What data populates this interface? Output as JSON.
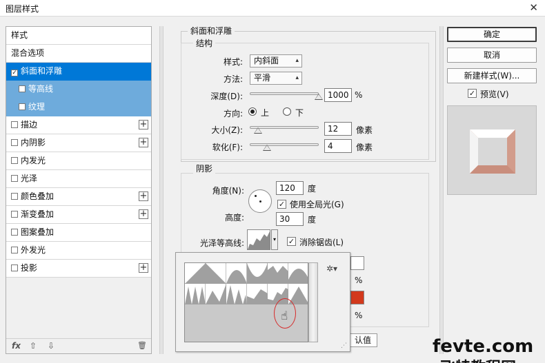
{
  "window": {
    "title": "图层样式",
    "close_glyph": "✕"
  },
  "styles_list": {
    "items": [
      {
        "label": "样式",
        "checkbox": false,
        "has_plus": false,
        "state": "normal"
      },
      {
        "label": "混合选项",
        "checkbox": false,
        "has_plus": false,
        "state": "normal"
      },
      {
        "label": "斜面和浮雕",
        "checkbox": true,
        "checked": true,
        "has_plus": false,
        "state": "selected"
      },
      {
        "label": "等高线",
        "checkbox": true,
        "checked": false,
        "has_plus": false,
        "state": "sub"
      },
      {
        "label": "纹理",
        "checkbox": true,
        "checked": false,
        "has_plus": false,
        "state": "sub"
      },
      {
        "label": "描边",
        "checkbox": true,
        "checked": false,
        "has_plus": true,
        "state": "normal"
      },
      {
        "label": "内阴影",
        "checkbox": true,
        "checked": false,
        "has_plus": true,
        "state": "normal"
      },
      {
        "label": "内发光",
        "checkbox": true,
        "checked": false,
        "has_plus": false,
        "state": "normal"
      },
      {
        "label": "光泽",
        "checkbox": true,
        "checked": false,
        "has_plus": false,
        "state": "normal"
      },
      {
        "label": "颜色叠加",
        "checkbox": true,
        "checked": false,
        "has_plus": true,
        "state": "normal"
      },
      {
        "label": "渐变叠加",
        "checkbox": true,
        "checked": false,
        "has_plus": true,
        "state": "normal"
      },
      {
        "label": "图案叠加",
        "checkbox": true,
        "checked": false,
        "has_plus": false,
        "state": "normal"
      },
      {
        "label": "外发光",
        "checkbox": true,
        "checked": false,
        "has_plus": false,
        "state": "normal"
      },
      {
        "label": "投影",
        "checkbox": true,
        "checked": false,
        "has_plus": true,
        "state": "normal"
      }
    ],
    "bottom": {
      "fx": "fx",
      "up": "⇧",
      "down": "⇩",
      "trash": "🗑"
    }
  },
  "bevel": {
    "section_title": "斜面和浮雕",
    "structure_title": "结构",
    "style_label": "样式:",
    "style_value": "内斜面",
    "method_label": "方法:",
    "method_value": "平滑",
    "depth_label": "深度(D):",
    "depth_value": "1000",
    "depth_unit": "%",
    "depth_slider_pct": 100,
    "direction_label": "方向:",
    "direction_up": "上",
    "direction_down": "下",
    "size_label": "大小(Z):",
    "size_value": "12",
    "size_unit": "像素",
    "size_slider_pct": 12,
    "soften_label": "软化(F):",
    "soften_value": "4",
    "soften_unit": "像素",
    "soften_slider_pct": 25
  },
  "shading": {
    "title": "阴影",
    "angle_label": "角度(N):",
    "angle_value": "120",
    "angle_unit": "度",
    "global_light_label": "使用全局光(G)",
    "altitude_label": "高度:",
    "altitude_value": "30",
    "altitude_unit": "度",
    "gloss_contour_label": "光泽等高线:",
    "antialias_label": "消除锯齿(L)",
    "pct1": "%",
    "pct2": "%",
    "reset_default_partial": "认值"
  },
  "buttons": {
    "ok": "确定",
    "cancel": "取消",
    "new_style": "新建样式(W)...",
    "preview_label": "预览(V)"
  },
  "colors": {
    "selected_row": "#0078d7",
    "sub_row": "#6eabdc",
    "shadow_color": "#d2391c",
    "highlight_color": "#ffffff",
    "preview_bevel": "#d9a595"
  },
  "watermark": {
    "line1": "fevte.com",
    "line2": "飞特教程网"
  }
}
